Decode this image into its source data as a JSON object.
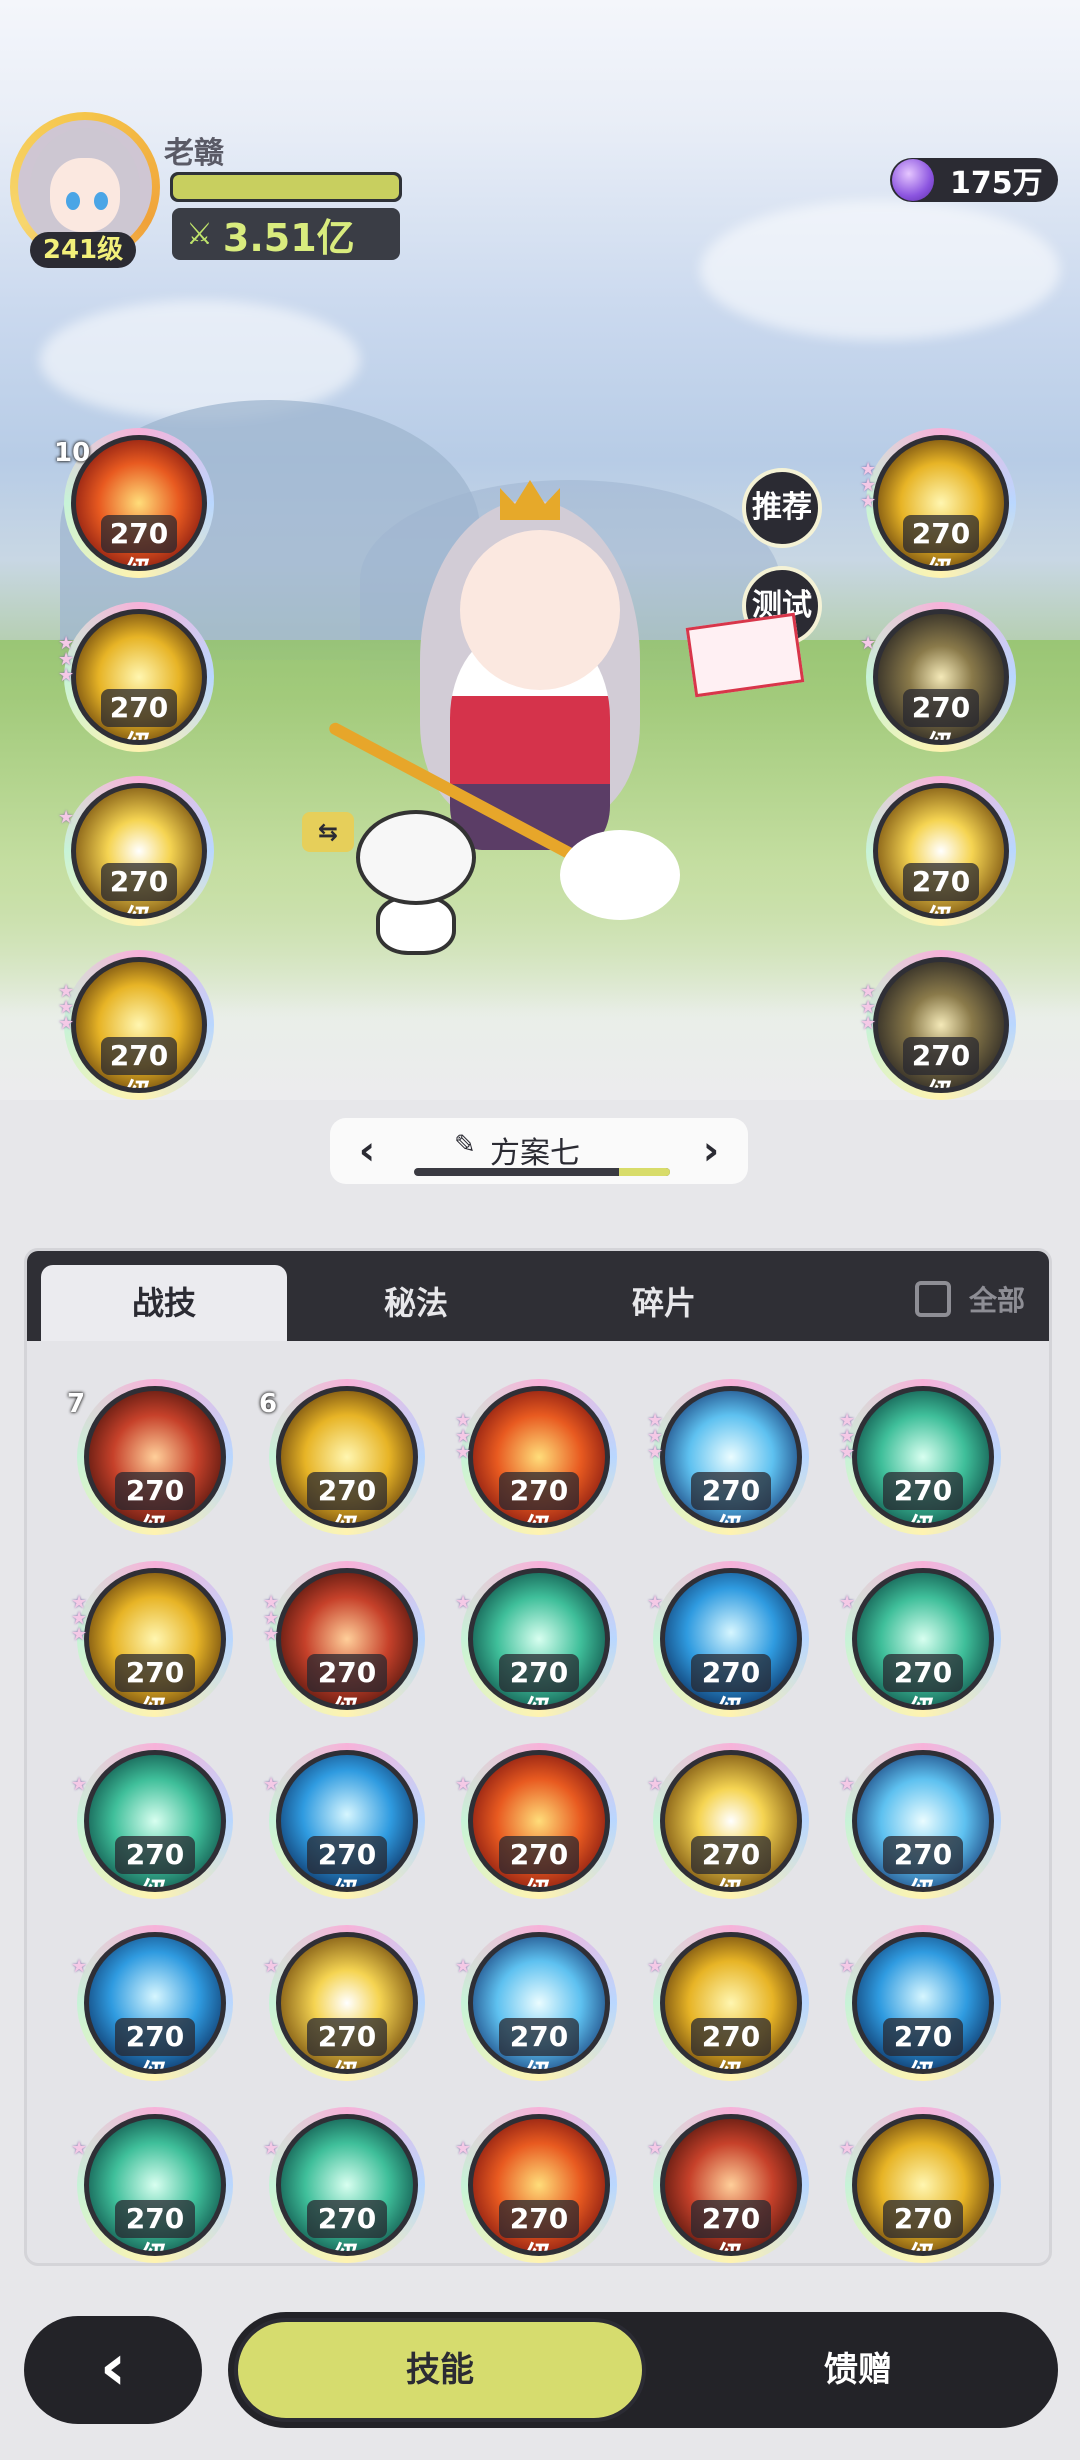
{
  "player": {
    "name": "老赣",
    "level": "241级",
    "power": "3.51亿",
    "power_icon": "crossed-swords-icon"
  },
  "currency": {
    "amount": "175万",
    "icon": "purple-gem-icon"
  },
  "side_buttons": {
    "recommend": "推荐",
    "test": "测试"
  },
  "left_orbs": [
    {
      "level": "270级",
      "badge": "10",
      "stars": 0,
      "style": "fire"
    },
    {
      "level": "270级",
      "badge": "",
      "stars": 3,
      "style": "gold"
    },
    {
      "level": "270级",
      "badge": "",
      "stars": 1,
      "style": "gold2"
    },
    {
      "level": "270级",
      "badge": "",
      "stars": 3,
      "style": "gold"
    }
  ],
  "right_orbs": [
    {
      "level": "270级",
      "stars": 3,
      "style": "gold"
    },
    {
      "level": "270级",
      "stars": 1,
      "style": "dark"
    },
    {
      "level": "270级",
      "stars": 0,
      "style": "gold2"
    },
    {
      "level": "270级",
      "stars": 3,
      "style": "dark"
    }
  ],
  "plan": {
    "name": "方案七",
    "progress": 0.2
  },
  "tabs": [
    {
      "label": "战技",
      "active": true
    },
    {
      "label": "秘法"
    },
    {
      "label": "碎片"
    }
  ],
  "all_label": "全部",
  "skills": [
    {
      "level": "270级",
      "badge": "7",
      "stars": 0,
      "style": "red"
    },
    {
      "level": "270级",
      "badge": "6",
      "stars": 0,
      "style": "gold"
    },
    {
      "level": "270级",
      "badge": "",
      "stars": 3,
      "style": "fire"
    },
    {
      "level": "270级",
      "badge": "",
      "stars": 3,
      "style": "ice"
    },
    {
      "level": "270级",
      "badge": "",
      "stars": 3,
      "style": "teal"
    },
    {
      "level": "270级",
      "badge": "",
      "stars": 3,
      "style": "gold"
    },
    {
      "level": "270级",
      "badge": "",
      "stars": 3,
      "style": "red"
    },
    {
      "level": "270级",
      "badge": "",
      "stars": 1,
      "style": "teal"
    },
    {
      "level": "270级",
      "badge": "",
      "stars": 1,
      "style": "water"
    },
    {
      "level": "270级",
      "badge": "",
      "stars": 1,
      "style": "teal"
    },
    {
      "level": "270级",
      "badge": "",
      "stars": 1,
      "style": "teal"
    },
    {
      "level": "270级",
      "badge": "",
      "stars": 1,
      "style": "water"
    },
    {
      "level": "270级",
      "badge": "",
      "stars": 1,
      "style": "fire"
    },
    {
      "level": "270级",
      "badge": "",
      "stars": 1,
      "style": "gold2"
    },
    {
      "level": "270级",
      "badge": "",
      "stars": 1,
      "style": "ice"
    },
    {
      "level": "270级",
      "badge": "",
      "stars": 1,
      "style": "water"
    },
    {
      "level": "270级",
      "badge": "",
      "stars": 1,
      "style": "gold2"
    },
    {
      "level": "270级",
      "badge": "",
      "stars": 1,
      "style": "ice"
    },
    {
      "level": "270级",
      "badge": "",
      "stars": 1,
      "style": "gold"
    },
    {
      "level": "270级",
      "badge": "",
      "stars": 1,
      "style": "water"
    },
    {
      "level": "270级",
      "badge": "",
      "stars": 1,
      "style": "teal"
    },
    {
      "level": "270级",
      "badge": "",
      "stars": 1,
      "style": "teal"
    },
    {
      "level": "270级",
      "badge": "",
      "stars": 1,
      "style": "fire"
    },
    {
      "level": "270级",
      "badge": "",
      "stars": 1,
      "style": "red"
    },
    {
      "level": "270级",
      "badge": "",
      "stars": 1,
      "style": "gold"
    }
  ],
  "bottom_nav": {
    "back_icon": "chevron-left-icon",
    "skills": "技能",
    "gift": "馈赠"
  }
}
